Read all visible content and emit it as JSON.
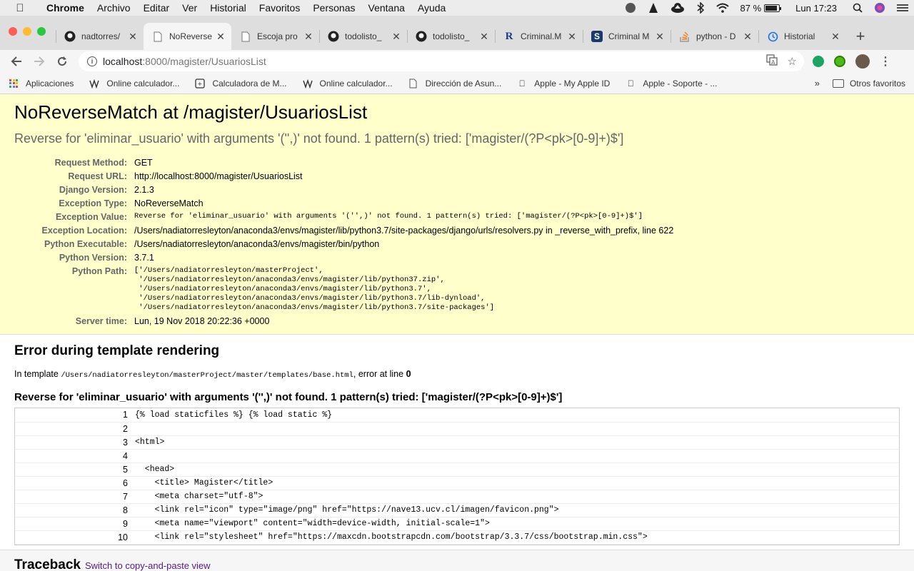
{
  "menubar": {
    "app": "Chrome",
    "items": [
      "Archivo",
      "Editar",
      "Ver",
      "Historial",
      "Favoritos",
      "Personas",
      "Ventana",
      "Ayuda"
    ],
    "battery": "87 %",
    "battery_level": 0.87,
    "clock": "Lun 17:23"
  },
  "tabs": [
    {
      "title": "nadtorres/",
      "icon": "github-icon"
    },
    {
      "title": "NoReverse",
      "icon": "page-icon",
      "active": true
    },
    {
      "title": "Escoja pro",
      "icon": "document-icon"
    },
    {
      "title": "todolisto_",
      "icon": "github-icon"
    },
    {
      "title": "todolisto_",
      "icon": "github-icon"
    },
    {
      "title": "Criminal.M",
      "icon": "r-icon"
    },
    {
      "title": "Criminal M",
      "icon": "s-icon"
    },
    {
      "title": "python - D",
      "icon": "stackoverflow-icon"
    },
    {
      "title": "Historial",
      "icon": "history-icon"
    }
  ],
  "address": {
    "host": "localhost",
    "path": ":8000/magister/UsuariosList"
  },
  "bookmarks": {
    "items": [
      {
        "label": "Aplicaciones",
        "icon": "apps-icon"
      },
      {
        "label": "Online calculador...",
        "icon": "calc-icon"
      },
      {
        "label": "Calculadora de M...",
        "icon": "calc-box-icon"
      },
      {
        "label": "Online calculador...",
        "icon": "calc-icon"
      },
      {
        "label": "Dirección de Asun...",
        "icon": "document-icon"
      },
      {
        "label": "Apple - My Apple ID",
        "icon": "apple-icon"
      },
      {
        "label": "Apple - Soporte - ...",
        "icon": "apple-icon"
      }
    ],
    "more": "»",
    "other": "Otros favoritos"
  },
  "error": {
    "title": "NoReverseMatch at /magister/UsuariosList",
    "subtitle": "Reverse for 'eliminar_usuario' with arguments '('',)' not found. 1 pattern(s) tried: ['magister/(?P<pk>[0-9]+)$']",
    "meta": [
      {
        "label": "Request Method:",
        "value": "GET"
      },
      {
        "label": "Request URL:",
        "value": "http://localhost:8000/magister/UsuariosList"
      },
      {
        "label": "Django Version:",
        "value": "2.1.3"
      },
      {
        "label": "Exception Type:",
        "value": "NoReverseMatch"
      },
      {
        "label": "Exception Value:",
        "value": "Reverse for 'eliminar_usuario' with arguments '('',)' not found. 1 pattern(s) tried: ['magister/(?P<pk>[0-9]+)$']",
        "mono": true
      },
      {
        "label": "Exception Location:",
        "value": "/Users/nadiatorresleyton/anaconda3/envs/magister/lib/python3.7/site-packages/django/urls/resolvers.py in _reverse_with_prefix, line 622"
      },
      {
        "label": "Python Executable:",
        "value": "/Users/nadiatorresleyton/anaconda3/envs/magister/bin/python"
      },
      {
        "label": "Python Version:",
        "value": "3.7.1"
      }
    ],
    "python_path_label": "Python Path:",
    "python_path": [
      "['/Users/nadiatorresleyton/masterProject',",
      " '/Users/nadiatorresleyton/anaconda3/envs/magister/lib/python37.zip',",
      " '/Users/nadiatorresleyton/anaconda3/envs/magister/lib/python3.7',",
      " '/Users/nadiatorresleyton/anaconda3/envs/magister/lib/python3.7/lib-dynload',",
      " '/Users/nadiatorresleyton/anaconda3/envs/magister/lib/python3.7/site-packages']"
    ],
    "server_time_label": "Server time:",
    "server_time": "Lun, 19 Nov 2018 20:22:36 +0000"
  },
  "template_error": {
    "heading": "Error during template rendering",
    "intro_prefix": "In template",
    "template_path": "/Users/nadiatorresleyton/masterProject/master/templates/base.html",
    "intro_suffix": ", error at line",
    "error_line": "0",
    "message": "Reverse for 'eliminar_usuario' with arguments '('',)' not found. 1 pattern(s) tried: ['magister/(?P<pk>[0-9]+)$']",
    "lines": [
      {
        "n": "1",
        "code": "{% load staticfiles %} {% load static %}"
      },
      {
        "n": "2",
        "code": ""
      },
      {
        "n": "3",
        "code": "<html>"
      },
      {
        "n": "4",
        "code": ""
      },
      {
        "n": "5",
        "code": "  <head>"
      },
      {
        "n": "6",
        "code": "    <title> Magister</title>"
      },
      {
        "n": "7",
        "code": "    <meta charset=\"utf-8\">"
      },
      {
        "n": "8",
        "code": "    <link rel=\"icon\" type=\"image/png\" href=\"https://nave13.ucv.cl/imagen/favicon.png\">"
      },
      {
        "n": "9",
        "code": "    <meta name=\"viewport\" content=\"width=device-width, initial-scale=1\">"
      },
      {
        "n": "10",
        "code": "    <link rel=\"stylesheet\" href=\"https://maxcdn.bootstrapcdn.com/bootstrap/3.3.7/css/bootstrap.min.css\">"
      }
    ]
  },
  "traceback": {
    "heading": "Traceback",
    "link": "Switch to copy-and-paste view"
  }
}
